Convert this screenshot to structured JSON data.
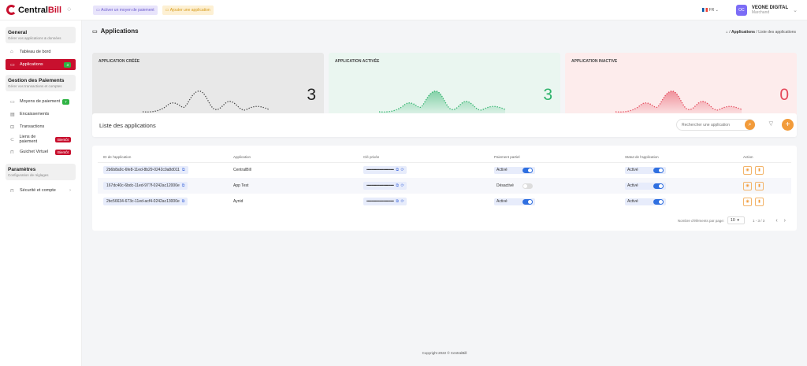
{
  "topbar": {
    "logo_brand_a": "Central",
    "logo_brand_b": "Bill",
    "pill_payment": "Activer un moyen de paiement",
    "pill_app": "Ajouter une application",
    "lang": "FR",
    "user_initials": "OC",
    "user_name": "VEONE DIGITAL",
    "user_role": "Marchand"
  },
  "sidebar": {
    "general_title": "General",
    "general_sub": "Gérer vos applications & données",
    "dashboard": "Tableau de bord",
    "applications": "Applications",
    "applications_count": "3",
    "payments_title": "Gestion des Paiements",
    "payments_sub": "Gérer vos transactions et comptes",
    "payment_methods": "Moyens de paiement",
    "payment_methods_count": "7",
    "collections": "Encaissements",
    "transactions": "Transactions",
    "payment_links": "Liens de paiement",
    "soon1": "Bientôt",
    "virtual_counter": "Guichet Virtuel",
    "soon2": "Bientôt",
    "settings_title": "Paramètres",
    "settings_sub": "Configuration de réglages",
    "security": "Sécurité et compte"
  },
  "page": {
    "title": "Applications",
    "crumb_1": "Applications",
    "crumb_sep": "/",
    "crumb_2": "Liste des applications"
  },
  "stats": [
    {
      "label": "APPLICATION CRÉÉE",
      "value": "3",
      "color": "#333333"
    },
    {
      "label": "APPLICATION ACTIVÉE",
      "value": "3",
      "color": "#2fb36c"
    },
    {
      "label": "APPLICATION INACTIVE",
      "value": "0",
      "color": "#e5485a"
    }
  ],
  "list": {
    "title": "Liste des applications",
    "search_placeholder": "Rechercher une application"
  },
  "table": {
    "headers": [
      "ID de l'application",
      "Application",
      "Clé privée",
      "Paiement partiel",
      "Statut de l'application",
      "Action"
    ],
    "rows": [
      {
        "id": "2b6b8a9c-6fe8-11ed-8b29-0242c0a8d011",
        "app": "CentralBill",
        "key": "••••••••••••••••••••••••••••••••",
        "partial": "Activé",
        "partial_on": true,
        "status": "Activé",
        "status_on": true
      },
      {
        "id": "167dc40c-6bdc-11ed-977f-0242ac12000e",
        "app": "App Test",
        "key": "••••••••••••••••••••••••••••••••",
        "partial": "Désactivé",
        "partial_on": false,
        "status": "Activé",
        "status_on": true
      },
      {
        "id": "2bc56634-673c-11ed-acf4-0242ac13000e",
        "app": "Aynid",
        "key": "••••••••••••••••••••••••••••••••",
        "partial": "Activé",
        "partial_on": true,
        "status": "Activé",
        "status_on": true
      }
    ]
  },
  "pager": {
    "per_page_label": "Nombre d'éléments par page:",
    "per_page": "10",
    "range": "1 - 3 / 3"
  },
  "footer": "Copyright 2022 © CentralBill"
}
